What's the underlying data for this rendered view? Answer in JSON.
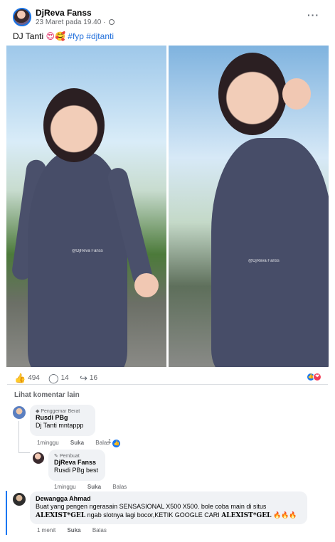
{
  "post": {
    "author": "DjReva Fanss",
    "meta": "23 Maret pada 19.40 ·",
    "more": "···",
    "caption_text": "DJ Tanti",
    "caption_emoji": "😍🥰",
    "caption_tags": "#fyp #djtanti"
  },
  "photos": {
    "watermark_left": "@DjReva Fanss",
    "watermark_right": "@DjReva Fanss"
  },
  "reactions": {
    "likes": "494",
    "comments": "14",
    "shares": "16",
    "badge_like": "👍",
    "badge_love": "❤"
  },
  "comments_link": "Lihat komentar lain",
  "comments": [
    {
      "label": "Penggemar Berat",
      "author": "Rusdi PBg",
      "text": "Dj Tanti mntappp",
      "time": "1minggu",
      "like": "Suka",
      "reply": "Balas",
      "count": "1"
    },
    {
      "label": "Pembuat",
      "author": "DjReva Fanss",
      "text": "Rusdi PBg best",
      "time": "1minggu",
      "like": "Suka",
      "reply": "Balas"
    },
    {
      "author": "Dewangga Ahmad",
      "text_pre": "Buat yang pengen ngerasain SENSASIONAL X500 X500. bole coba main di situs",
      "brand1": "ALEXIST*GEL",
      "text_mid": "ngab slotnya lagi bocor,KETIK GOOGLE CARI",
      "brand2": "ALEXIST*GEL",
      "fire": "🔥🔥🔥",
      "time": "1 menit",
      "like": "Suka",
      "reply": "Balas"
    }
  ],
  "icons": [
    "globe-icon",
    "more-icon",
    "like-icon",
    "comment-icon",
    "share-icon",
    "fan-badge-icon",
    "creator-badge-icon"
  ],
  "colors": {
    "link": "#216fdb",
    "like": "#1877f2",
    "love": "#f33e58"
  }
}
